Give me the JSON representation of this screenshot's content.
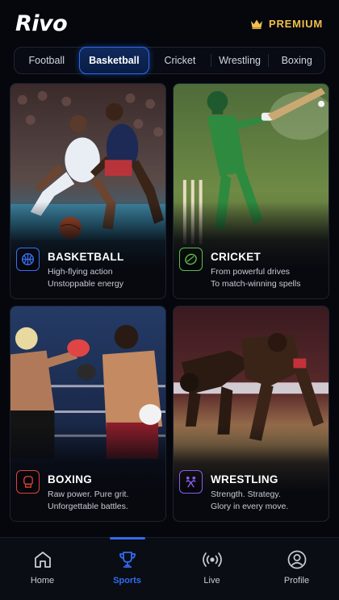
{
  "app": {
    "logo": "Rivo",
    "premium_label": "PREMIUM",
    "premium_icon": "crown-icon",
    "accent": "#2f6cf0",
    "gold": "#f2c04a"
  },
  "tabs": [
    {
      "label": "Football",
      "active": false
    },
    {
      "label": "Basketball",
      "active": true
    },
    {
      "label": "Cricket",
      "active": false
    },
    {
      "label": "Wrestling",
      "active": false
    },
    {
      "label": "Boxing",
      "active": false
    }
  ],
  "cards": [
    {
      "title": "BASKETBALL",
      "line1": "High-flying action",
      "line2": "Unstoppable energy",
      "icon": "basketball-icon",
      "color": "#3b6ff5"
    },
    {
      "title": "CRICKET",
      "line1": "From powerful drives",
      "line2": "To match-winning spells",
      "icon": "cricket-ball-icon",
      "color": "#5fbf4a"
    },
    {
      "title": "BOXING",
      "line1": "Raw power. Pure grit.",
      "line2": "Unforgettable battles.",
      "icon": "boxing-glove-icon",
      "color": "#e0433a"
    },
    {
      "title": "WRESTLING",
      "line1": "Strength. Strategy.",
      "line2": "Glory in every move.",
      "icon": "wrestling-icon",
      "color": "#8a5cf0"
    }
  ],
  "nav": [
    {
      "label": "Home",
      "icon": "home-icon",
      "active": false
    },
    {
      "label": "Sports",
      "icon": "trophy-icon",
      "active": true
    },
    {
      "label": "Live",
      "icon": "live-broadcast-icon",
      "active": false
    },
    {
      "label": "Profile",
      "icon": "user-icon",
      "active": false
    }
  ]
}
